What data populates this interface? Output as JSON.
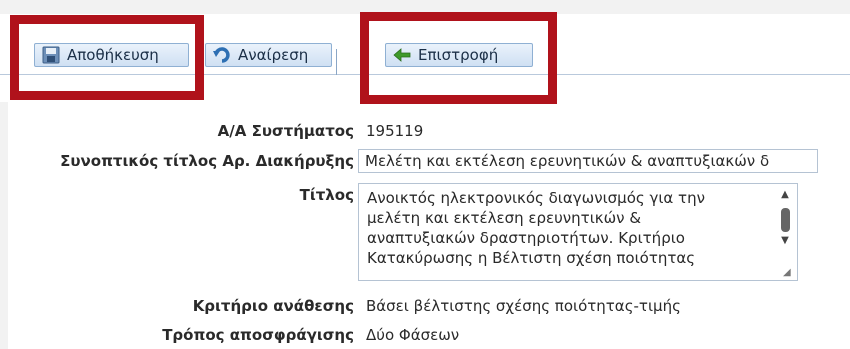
{
  "toolbar": {
    "save_label": "Αποθήκευση",
    "undo_label": "Αναίρεση",
    "back_label": "Επιστροφή"
  },
  "form": {
    "system_id": {
      "label": "Α/Α Συστήματος",
      "value": "195119"
    },
    "summary_title": {
      "label": "Συνοπτικός τίτλος Αρ. Διακήρυξης",
      "value": "Μελέτη και εκτέλεση ερευνητικών & αναπτυξιακών δ"
    },
    "title": {
      "label": "Τίτλος",
      "lines": [
        "Ανοικτός ηλεκτρονικός διαγωνισμός για την",
        "μελέτη και εκτέλεση ερευνητικών &",
        "αναπτυξιακών δραστηριοτήτων. Κριτήριο",
        "Κατακύρωσης η Βέλτιστη σχέση ποιότητας"
      ]
    },
    "award_criterion": {
      "label": "Κριτήριο ανάθεσης",
      "value": "Βάσει βέλτιστης σχέσης ποιότητας-τιμής"
    },
    "unsealing_method": {
      "label": "Τρόπος αποσφράγισης",
      "value": "Δύο Φάσεων"
    }
  },
  "colors": {
    "highlight": "#b0121b",
    "button_border": "#8fb0d3"
  },
  "icons": {
    "save": "floppy-disk-icon",
    "undo": "undo-arrow-icon",
    "back": "back-arrow-icon"
  }
}
